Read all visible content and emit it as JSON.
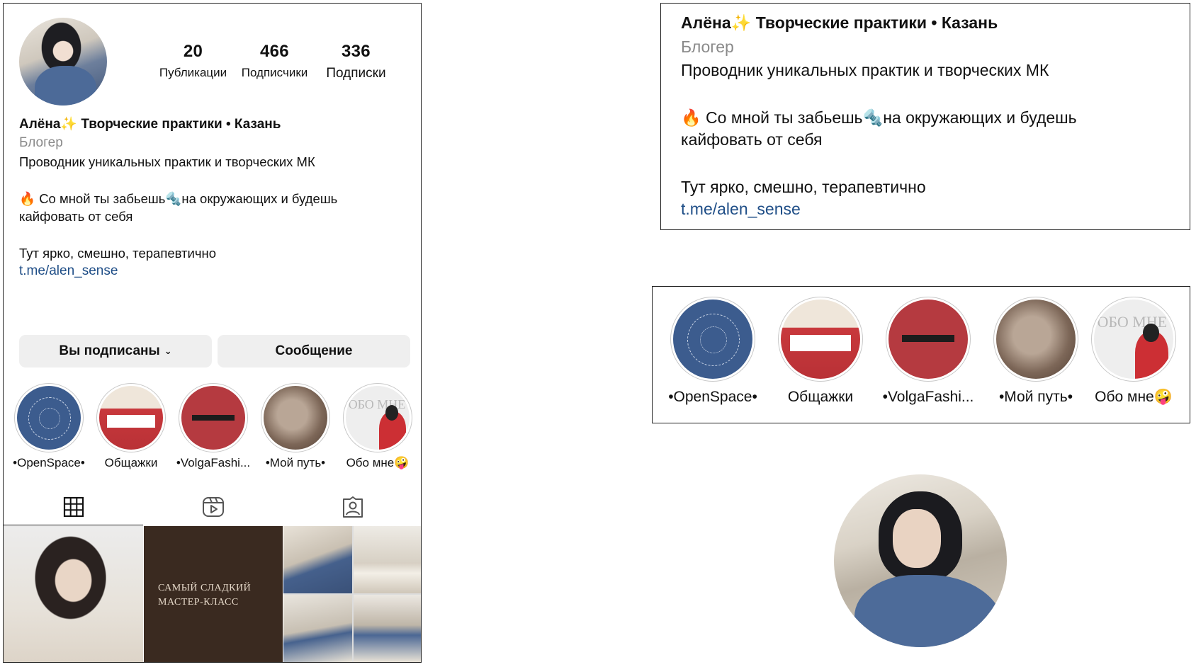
{
  "profile": {
    "stats": [
      {
        "value": "20",
        "label": "Публикации"
      },
      {
        "value": "466",
        "label": "Подписчики"
      },
      {
        "value": "336",
        "label": "Подписки"
      }
    ],
    "name_part1": "Алёна",
    "name_sparkle": "✨",
    "name_part2": "Творческие практики • Казань",
    "category": "Блогер",
    "bio_line1": "Проводник уникальных практик и творческих МК",
    "bio_fire": "🔥",
    "bio_line2a": "Со мной ты забьешь",
    "bio_wrench": "🔩",
    "bio_line2b": "на окружающих и будешь",
    "bio_line3": "кайфовать от себя",
    "bio_line4": "Тут ярко, смешно, терапевтично",
    "link": "t.me/alen_sense"
  },
  "actions": {
    "following_label": "Вы подписаны",
    "following_chevron": "⌄",
    "message_label": "Сообщение"
  },
  "highlights": [
    {
      "label": "•OpenSpace•",
      "icon": "openspace-cover"
    },
    {
      "label": "Общажки",
      "icon": "obshazhki-cover"
    },
    {
      "label": "•VolgaFashi...",
      "icon": "volgafashion-cover"
    },
    {
      "label": "•Мой путь•",
      "icon": "moy-put-cover"
    },
    {
      "label": "Обо мне",
      "emoji": "🤪",
      "cover_text": "ОБО МНЕ"
    }
  ],
  "tabs": [
    {
      "name": "grid",
      "icon": "grid-icon",
      "active": true
    },
    {
      "name": "reels",
      "icon": "reels-icon",
      "active": false
    },
    {
      "name": "tagged",
      "icon": "tagged-icon",
      "active": false
    }
  ],
  "posts": [
    {
      "kind": "portrait"
    },
    {
      "kind": "text",
      "text_line1": "САМЫЙ СЛАДКИЙ",
      "text_line2": "МАСТЕР-КЛАСС"
    },
    {
      "kind": "collage"
    }
  ],
  "colors": {
    "link": "#1f4e87",
    "button_bg": "#efefef",
    "muted": "#8a8a8a"
  }
}
